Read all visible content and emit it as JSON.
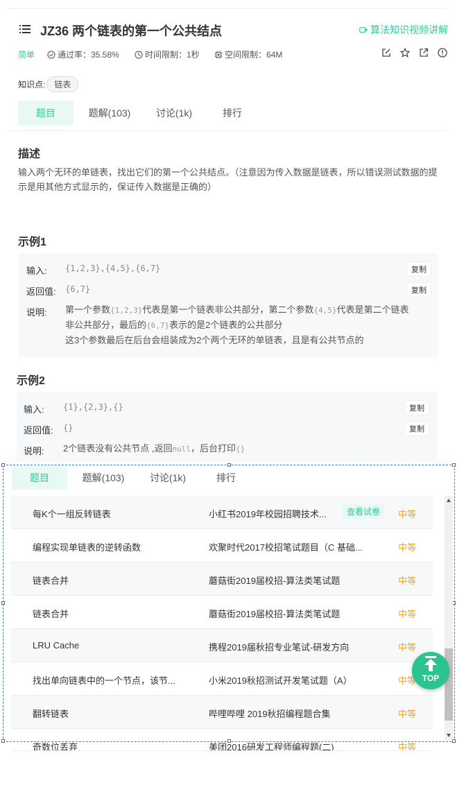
{
  "header": {
    "title": "JZ36  两个链表的第一个公共结点",
    "video_link": "算法知识视频讲解"
  },
  "meta": {
    "difficulty": "简单",
    "pass_rate": "通过率：35.58%",
    "time_limit": "时间限制：1秒",
    "space_limit": "空间限制：64M"
  },
  "knowledge": {
    "label": "知识点:",
    "chip": "链表"
  },
  "tabs": [
    {
      "label": "题目"
    },
    {
      "label": "题解(103)"
    },
    {
      "label": "讨论(1k)"
    },
    {
      "label": "排行"
    }
  ],
  "description": {
    "heading": "描述",
    "text": "输入两个无环的单链表，找出它们的第一个公共结点。（注意因为传入数据是链表，所以错误测试数据的提示是用其他方式显示的，保证传入数据是正确的）"
  },
  "example1": {
    "heading": "示例1",
    "input_label": "输入:",
    "input_value": "{1,2,3},{4,5},{6,7}",
    "return_label": "返回值:",
    "return_value": "{6,7}",
    "explain_label": "说明:",
    "copy": "复制",
    "explain": {
      "a": "第一个参数",
      "b": "{1,2,3}",
      "c": "代表是第一个链表非公共部分，第二个参数",
      "d": "{4,5}",
      "e": "代表是第二个链表非公共部分，最后的",
      "f": "{6,7}",
      "g": "表示的是2个链表的公共部分",
      "h": "这3个参数最后在后台会组装成为2个两个无环的单链表，且是有公共节点的"
    }
  },
  "example2": {
    "heading": "示例2",
    "input_label": "输入:",
    "input_value": "{1},{2,3},{}",
    "return_label": "返回值:",
    "return_value": "{}",
    "explain_label": "说明:",
    "copy": "复制",
    "explain": {
      "a": "2个链表没有公共节点 ,返回",
      "b": "null",
      "c": "，后台打印",
      "d": "{}"
    }
  },
  "overlay": {
    "tabs": [
      {
        "label": "题目"
      },
      {
        "label": "题解(103)"
      },
      {
        "label": "讨论(1k)"
      },
      {
        "label": "排行"
      }
    ],
    "rows": [
      {
        "title": "每K个一组反转链表",
        "source": "小红书2019年校园招聘技术...",
        "tag": "查看试卷",
        "level": "中等"
      },
      {
        "title": "编程实现单链表的逆转函数",
        "source": "欢聚时代2017校招笔试题目（C 基础...",
        "tag": "",
        "level": "中等"
      },
      {
        "title": "链表合并",
        "source": "蘑菇街2019届校招-算法类笔试题",
        "tag": "",
        "level": "中等"
      },
      {
        "title": "链表合并",
        "source": "蘑菇街2019届校招-算法类笔试题",
        "tag": "",
        "level": "中等"
      },
      {
        "title": "LRU Cache",
        "source": "携程2019届秋招专业笔试-研发方向",
        "tag": "",
        "level": "中等"
      },
      {
        "title": "找出单向链表中的一个节点，该节...",
        "source": "小米2019秋招测试开发笔试题（A）",
        "tag": "",
        "level": "中等"
      },
      {
        "title": "翻转链表",
        "source": "哔哩哔哩 2019秋招编程题合集",
        "tag": "",
        "level": "中等"
      },
      {
        "title": "奇数位丢弃",
        "source": "美团2016研发工程师编程题(二)",
        "tag": "",
        "level": "中等"
      }
    ]
  },
  "top_button": "TOP",
  "colors": {
    "accent": "#32ca99",
    "medium": "#f5a623",
    "overlay_border": "#3b7cc4"
  }
}
